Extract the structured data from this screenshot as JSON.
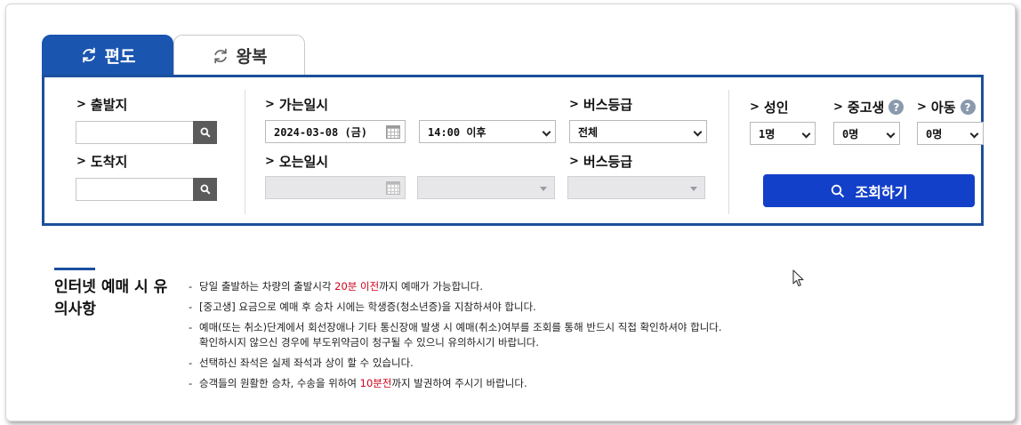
{
  "tabs": [
    {
      "label": "편도",
      "active": true
    },
    {
      "label": "왕복",
      "active": false
    }
  ],
  "departure": {
    "label": "출발지",
    "value": ""
  },
  "arrival": {
    "label": "도착지",
    "value": ""
  },
  "outbound": {
    "label": "가는일시",
    "date": "2024-03-08 (금)",
    "time": "14:00 이후",
    "grade_label": "버스등급",
    "grade": "전체"
  },
  "return": {
    "label": "오는일시",
    "date": "",
    "time": "",
    "grade_label": "버스등급",
    "grade": ""
  },
  "passengers": {
    "adult": {
      "label": "성인",
      "value": "1명"
    },
    "student": {
      "label": "중고생",
      "value": "0명"
    },
    "child": {
      "label": "아동",
      "value": "0명"
    },
    "help_glyph": "?"
  },
  "query_button": "조회하기",
  "notice": {
    "title": "인터넷 예매 시 유의사항",
    "items": [
      {
        "before": "당일 출발하는 차량의 출발시각 ",
        "highlight": "20분 이전",
        "after": "까지 예매가 가능합니다."
      },
      {
        "before": "[중고생] 요금으로 예매 후 승차 시에는 학생증(청소년증)을 지참하셔야 합니다.",
        "highlight": "",
        "after": ""
      },
      {
        "before": "예매(또는 취소)단계에서 회선장애나 기타 통신장애 발생 시 예매(취소)여부를 조회를 통해 반드시 직접 확인하셔야 합니다.",
        "highlight": "",
        "after": "",
        "line2": "확인하시지 않으신 경우에 부도위약금이 청구될 수 있으니 유의하시기 바랍니다."
      },
      {
        "before": "선택하신 좌석은 실제 좌석과 상이 할 수 있습니다.",
        "highlight": "",
        "after": ""
      },
      {
        "before": "승객들의 원활한 승차, 수송을 위하여 ",
        "highlight": "10분전",
        "after": "까지 발권하여 주시기 바랍니다."
      }
    ]
  },
  "colors": {
    "tab_active": "#1a55b0",
    "panel_border": "#1c4f9c",
    "query_button": "#1340c8",
    "highlight_text": "#d0021b"
  }
}
